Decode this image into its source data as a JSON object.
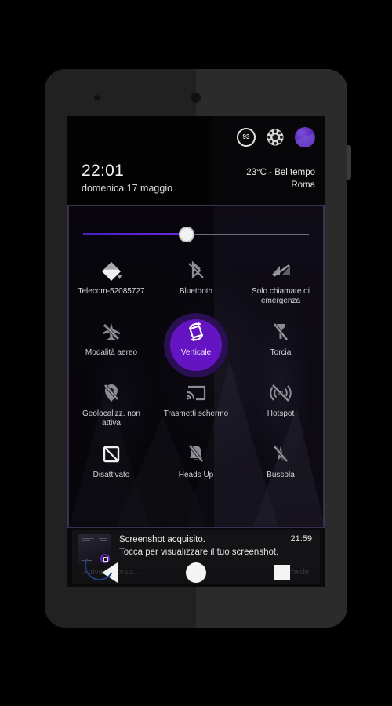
{
  "device": {
    "frame_color": "#2b2b2b",
    "accent": "#6414c2"
  },
  "status_bar": {
    "battery_icon": "battery-circle-icon",
    "battery_level": "93",
    "settings_icon": "gear-icon",
    "avatar_icon": "user-avatar"
  },
  "header": {
    "time": "22:01",
    "date": "domenica 17 maggio",
    "weather_line1": "23°C - Bel tempo",
    "weather_line2": "Roma"
  },
  "brightness": {
    "name": "brightness-slider",
    "value_percent": 47,
    "fill_color": "#5a22d6"
  },
  "tiles": [
    {
      "id": "wifi",
      "label": "Telecom-52085727",
      "icon": "wifi-icon",
      "active": false
    },
    {
      "id": "bluetooth",
      "label": "Bluetooth",
      "icon": "bluetooth-off-icon",
      "active": false
    },
    {
      "id": "signal",
      "label": "Solo chiamate di emergenza",
      "icon": "cell-signal-off-icon",
      "active": false
    },
    {
      "id": "airplane",
      "label": "Modalità aereo",
      "icon": "airplane-off-icon",
      "active": false
    },
    {
      "id": "rotation",
      "label": "Verticale",
      "icon": "screen-rotation-icon",
      "active": true
    },
    {
      "id": "flashlight",
      "label": "Torcia",
      "icon": "flashlight-off-icon",
      "active": false
    },
    {
      "id": "location",
      "label": "Geolocalizz. non attiva",
      "icon": "location-off-icon",
      "active": false
    },
    {
      "id": "cast",
      "label": "Trasmetti schermo",
      "icon": "cast-icon",
      "active": false
    },
    {
      "id": "hotspot",
      "label": "Hotspot",
      "icon": "hotspot-off-icon",
      "active": false
    },
    {
      "id": "screenshot",
      "label": "Disattivato",
      "icon": "screenshot-off-icon",
      "active": false
    },
    {
      "id": "headsup",
      "label": "Heads Up",
      "icon": "bell-off-icon",
      "active": false
    },
    {
      "id": "compass",
      "label": "Bussola",
      "icon": "compass-off-icon",
      "active": false
    }
  ],
  "notification": {
    "title": "Screenshot acquisito.",
    "subtitle": "Tocca per visualizzare il tuo screenshot.",
    "time": "21:59",
    "thumb_icon": "screenshot-thumbnail"
  },
  "hidden_notification": {
    "left_text": "Attiva in corso…",
    "right_text": "schede"
  },
  "nav_bar": {
    "back_label": "back-button",
    "home_label": "home-button",
    "recents_label": "recents-button"
  }
}
